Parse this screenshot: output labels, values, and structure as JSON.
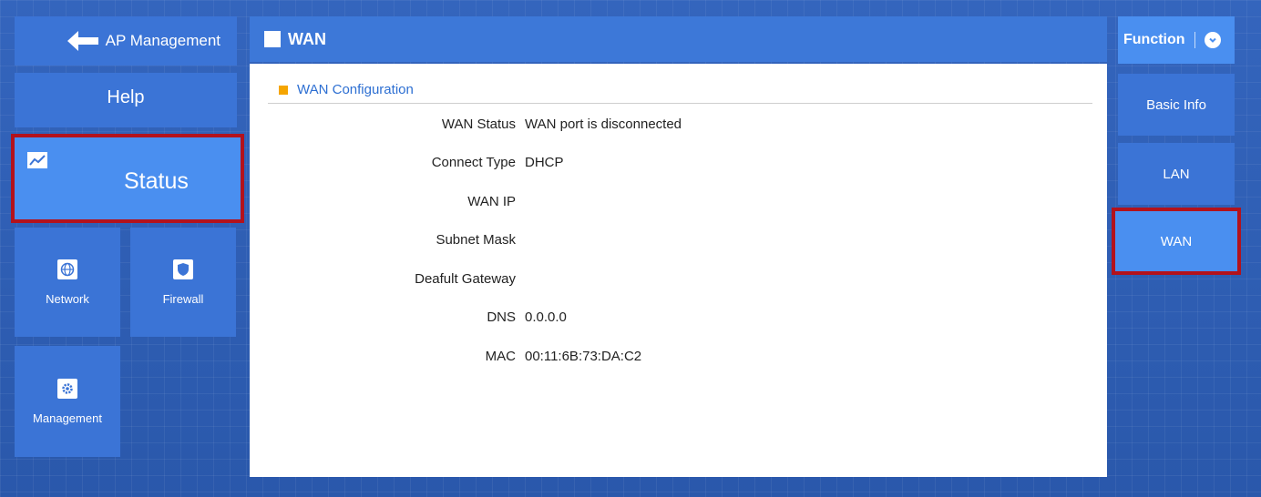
{
  "left_nav": {
    "back_label": "AP Management",
    "help_label": "Help",
    "status_label": "Status",
    "network_label": "Network",
    "firewall_label": "Firewall",
    "management_label": "Management"
  },
  "header": {
    "title": "WAN"
  },
  "section": {
    "title": "WAN Configuration",
    "rows": [
      {
        "label": "WAN Status",
        "value": "WAN port is disconnected"
      },
      {
        "label": "Connect Type",
        "value": "DHCP"
      },
      {
        "label": "WAN IP",
        "value": ""
      },
      {
        "label": "Subnet Mask",
        "value": ""
      },
      {
        "label": "Deafult Gateway",
        "value": ""
      },
      {
        "label": "DNS",
        "value": "0.0.0.0"
      },
      {
        "label": "MAC",
        "value": "00:11:6B:73:DA:C2"
      }
    ]
  },
  "right_nav": {
    "function_label": "Function",
    "items": [
      "Basic Info",
      "LAN",
      "WAN"
    ]
  },
  "colors": {
    "background": "#2f5fb4",
    "tile": "#3b74d6",
    "active_tile": "#4a8ff0",
    "highlight_border": "#b3121c",
    "section_marker": "#f5a500",
    "section_title": "#2d6fd2"
  },
  "icons": [
    "back-arrow-icon",
    "chart-icon",
    "globe-icon",
    "shield-icon",
    "gear-icon",
    "chevron-down-icon"
  ]
}
